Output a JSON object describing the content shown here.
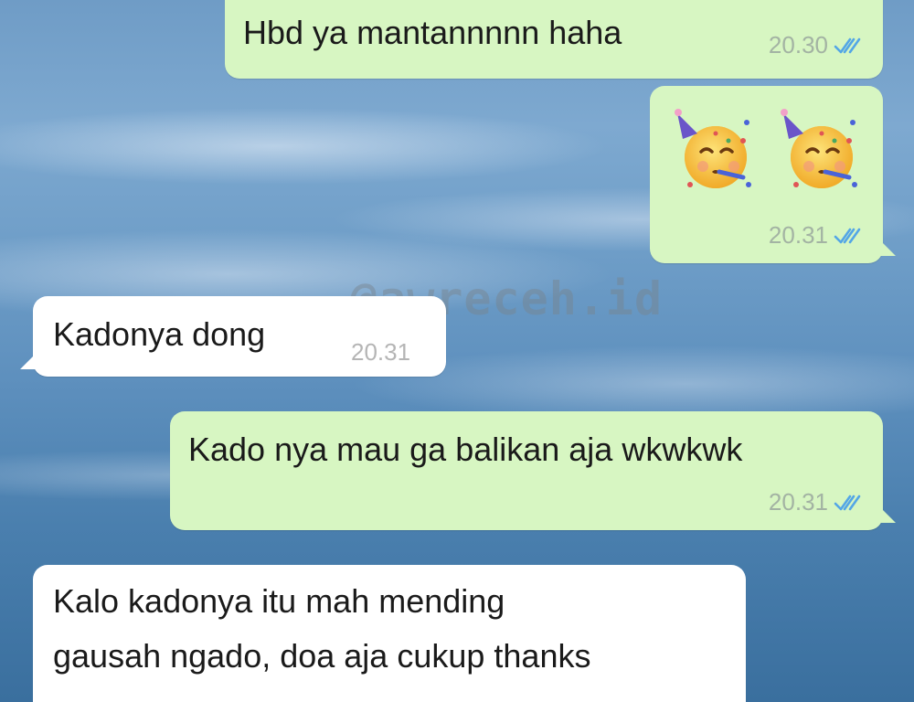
{
  "watermark": "@awreceh.id",
  "messages": [
    {
      "direction": "outgoing",
      "text": "Hbd ya mantannnnn haha",
      "time": "20.30",
      "status": "read"
    },
    {
      "direction": "outgoing",
      "emoji": [
        "partying-face",
        "partying-face"
      ],
      "time": "20.31",
      "status": "read"
    },
    {
      "direction": "incoming",
      "text": "Kadonya dong",
      "time": "20.31"
    },
    {
      "direction": "outgoing",
      "text": "Kado nya mau ga balikan aja wkwkwk",
      "time": "20.31",
      "status": "read"
    },
    {
      "direction": "incoming",
      "lines": [
        "Kalo kadonya itu mah mending",
        "gausah ngado, doa aja cukup thanks"
      ]
    }
  ],
  "colors": {
    "outgoing_bubble": "#d7f6c2",
    "incoming_bubble": "#ffffff",
    "read_tick": "#53a6e6",
    "wallpaper": "#6f9cc6"
  },
  "icons": {
    "read_receipt": "double-check-icon",
    "emoji": "partying-face-emoji"
  }
}
